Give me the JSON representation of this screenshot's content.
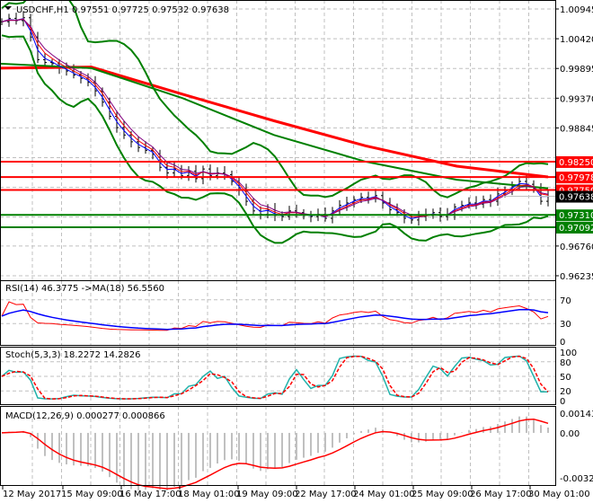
{
  "chart_data": {
    "type": "ohlc",
    "symbol_label": "USDCHF,H1",
    "ohlc_header": "0.97551 0.97725 0.97532 0.97638",
    "price_ylim": [
      0.96235,
      1.00945
    ],
    "price_ticks": [
      "1.00945",
      "1.00420",
      "0.99895",
      "0.99370",
      "0.98845",
      "0.96760",
      "0.96235"
    ],
    "x_tick_labels": [
      "12 May 2017",
      "15 May 09:00",
      "16 May 17:00",
      "18 May 01:00",
      "19 May 09:00",
      "22 May 17:00",
      "24 May 01:00",
      "25 May 09:00",
      "26 May 17:00",
      "30 May 01:00"
    ],
    "closes": [
      1.0072,
      1.0078,
      1.0074,
      1.0079,
      1.0045,
      1.0005,
      1.0,
      0.9998,
      0.999,
      0.9985,
      0.9978,
      0.9972,
      0.9965,
      0.995,
      0.993,
      0.9905,
      0.9885,
      0.9872,
      0.986,
      0.985,
      0.9845,
      0.9838,
      0.9815,
      0.9805,
      0.9812,
      0.98,
      0.9808,
      0.9795,
      0.9812,
      0.98,
      0.9805,
      0.9802,
      0.979,
      0.9775,
      0.9755,
      0.9738,
      0.9732,
      0.974,
      0.973,
      0.9728,
      0.9738,
      0.9735,
      0.973,
      0.9728,
      0.9732,
      0.9725,
      0.9738,
      0.9748,
      0.9752,
      0.9758,
      0.9762,
      0.976,
      0.9765,
      0.9752,
      0.974,
      0.9735,
      0.9725,
      0.9722,
      0.9728,
      0.973,
      0.9735,
      0.9728,
      0.9732,
      0.9745,
      0.9748,
      0.9752,
      0.975,
      0.9758,
      0.9755,
      0.9768,
      0.9775,
      0.9782,
      0.979,
      0.9785,
      0.9778,
      0.9755,
      0.97638
    ],
    "ma_slow_red": [
      0.999,
      0.9992,
      0.9944,
      0.9897,
      0.9853,
      0.9817,
      0.9798
    ],
    "ma_mid_green": [
      0.9998,
      0.999,
      0.9937,
      0.9872,
      0.9825,
      0.9793,
      0.9778
    ],
    "levels": [
      {
        "value": "0.98250",
        "color": "#ff0000"
      },
      {
        "value": "0.97978",
        "color": "#ff0000"
      },
      {
        "value": "0.97750",
        "color": "#ff0000"
      },
      {
        "value": "0.97638",
        "color": "#000000"
      },
      {
        "value": "0.97310",
        "color": "#008000"
      },
      {
        "value": "0.97092",
        "color": "#008000"
      }
    ],
    "rsi": {
      "label": "RSI(14) 46.3775  ->MA(18) 56.5560",
      "ticks": [
        "70",
        "30",
        "0"
      ],
      "ylim": [
        0,
        100
      ],
      "colors": {
        "rsi": "#ff0000",
        "ma": "#0000ff"
      }
    },
    "stoch": {
      "label": "Stoch(5,3,3) 18.2272 14.2826",
      "ticks": [
        "100",
        "80",
        "50",
        "20",
        "0"
      ],
      "ylim": [
        0,
        100
      ],
      "colors": {
        "main": "#20b2aa",
        "signal": "#ff0000"
      }
    },
    "macd": {
      "label": "MACD(12,26,9) 0.000277 0.000866",
      "ticks": [
        "0.001434",
        "0.00",
        "-0.003272"
      ],
      "ylim": [
        -0.003272,
        0.001434
      ],
      "colors": {
        "histogram": "#c0c0c0",
        "signal": "#ff0000"
      }
    }
  }
}
